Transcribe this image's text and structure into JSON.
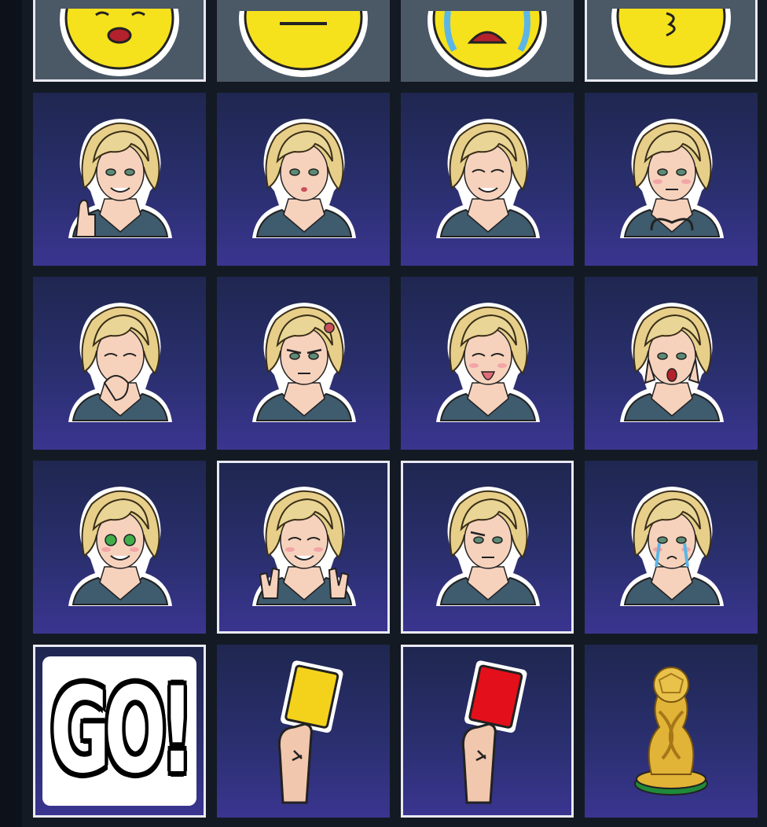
{
  "board": {
    "emoji_row": [
      {
        "icon": "yawning-emoji-icon",
        "selected": true
      },
      {
        "icon": "neutral-face-emoji-icon",
        "selected": false
      },
      {
        "icon": "crying-emoji-icon",
        "selected": false
      },
      {
        "icon": "kiss-face-emoji-icon",
        "selected": true
      }
    ],
    "sticker_rows": [
      [
        {
          "icon": "girl-thumbs-up-sticker-icon",
          "selected": false
        },
        {
          "icon": "girl-pouting-sticker-icon",
          "selected": false
        },
        {
          "icon": "girl-smiling-eyes-closed-sticker-icon",
          "selected": false
        },
        {
          "icon": "girl-heart-hands-sticker-icon",
          "selected": false
        }
      ],
      [
        {
          "icon": "girl-yawning-sticker-icon",
          "selected": false
        },
        {
          "icon": "girl-angry-sticker-icon",
          "selected": false
        },
        {
          "icon": "girl-tongue-out-sticker-icon",
          "selected": false
        },
        {
          "icon": "girl-shocked-sticker-icon",
          "selected": false
        }
      ],
      [
        {
          "icon": "girl-money-eyes-sticker-icon",
          "selected": false
        },
        {
          "icon": "girl-peace-sign-sticker-icon",
          "selected": true
        },
        {
          "icon": "girl-skeptical-sticker-icon",
          "selected": true
        },
        {
          "icon": "girl-crying-sticker-icon",
          "selected": false
        }
      ]
    ],
    "bottom_row": [
      {
        "icon": "go-sticker-icon",
        "label": "GO!",
        "selected": true
      },
      {
        "icon": "yellow-card-icon",
        "selected": false
      },
      {
        "icon": "red-card-icon",
        "selected": true
      },
      {
        "icon": "trophy-icon",
        "selected": false
      }
    ]
  },
  "colors": {
    "page_bg": "#141a24",
    "tile_top": "#1f2750",
    "tile_bottom": "#3a3590",
    "emoji_tile": "#4b5866",
    "selected_border": "#e9e9f2",
    "emoji_yellow": "#f6e11d",
    "hair": "#e7cf8a",
    "skin": "#f6d2bd",
    "jacket": "#3f5b6e",
    "yellow_card": "#f4d21c",
    "red_card": "#e3101b",
    "trophy_gold": "#e1b337"
  }
}
